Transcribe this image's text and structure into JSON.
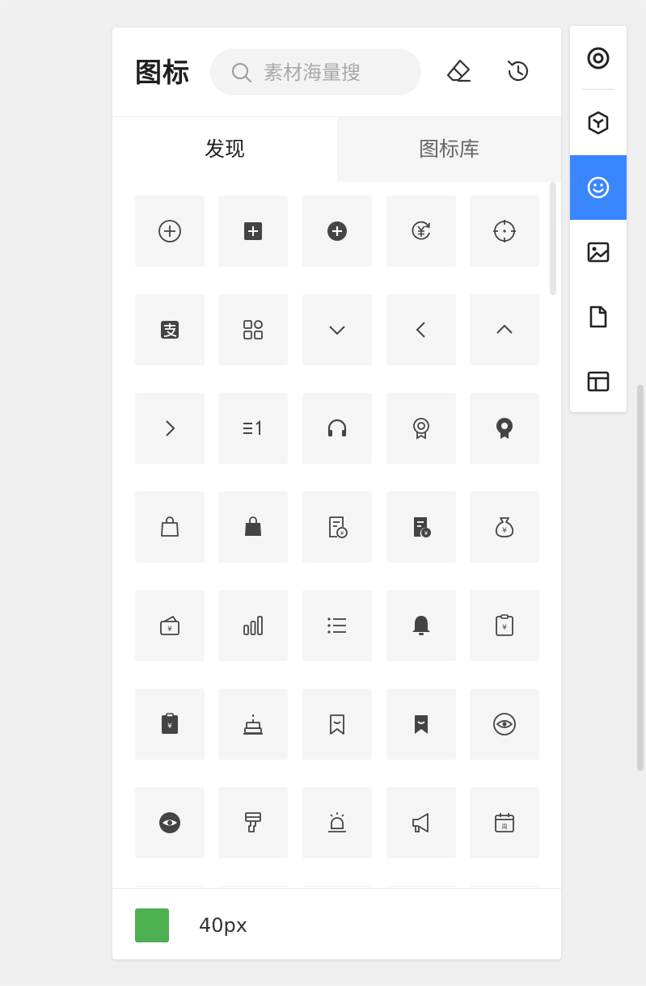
{
  "panel": {
    "title": "图标",
    "search": {
      "placeholder": "素材海量搜",
      "value": ""
    },
    "header_buttons": [
      {
        "name": "clear-style-button",
        "icon": "eraser-icon"
      },
      {
        "name": "history-button",
        "icon": "history-icon"
      }
    ],
    "tabs": [
      {
        "label": "发现",
        "active": true
      },
      {
        "label": "图标库",
        "active": false
      }
    ],
    "icon_grid": [
      [
        "add-circle-outline-icon",
        "add-square-filled-icon",
        "add-circle-filled-icon",
        "yuan-exchange-icon",
        "crosshair-icon"
      ],
      [
        "alipay-icon",
        "app-grid-icon",
        "chevron-down-icon",
        "chevron-left-icon",
        "chevron-up-icon"
      ],
      [
        "chevron-right-icon",
        "ordered-list-icon",
        "headphones-icon",
        "medal-outline-icon",
        "medal-filled-icon"
      ],
      [
        "shopping-bag-outline-icon",
        "shopping-bag-filled-icon",
        "bill-outline-icon",
        "bill-filled-icon",
        "money-bag-icon"
      ],
      [
        "wallet-icon",
        "bar-chart-icon",
        "list-icon",
        "bell-filled-icon",
        "clipboard-yuan-outline-icon"
      ],
      [
        "clipboard-yuan-filled-icon",
        "birthday-cake-icon",
        "bookmark-outline-icon",
        "bookmark-filled-icon",
        "eye-outline-icon"
      ],
      [
        "eye-filled-icon",
        "paint-brush-icon",
        "alarm-light-icon",
        "megaphone-icon",
        "calendar-week-icon"
      ]
    ],
    "footer": {
      "color": "#4caf50",
      "size": "40px"
    }
  },
  "side_toolbar": [
    {
      "name": "target-icon",
      "active": false
    },
    {
      "name": "cube-icon",
      "active": false
    },
    {
      "name": "smiley-icon",
      "active": true
    },
    {
      "name": "image-icon",
      "active": false
    },
    {
      "name": "file-icon",
      "active": false
    },
    {
      "name": "layout-icon",
      "active": false
    }
  ],
  "colors": {
    "accent": "#3a86ff",
    "icon": "#444444"
  }
}
